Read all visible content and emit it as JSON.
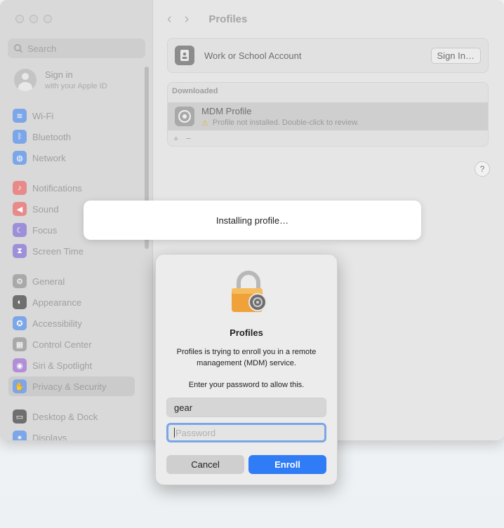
{
  "sidebar": {
    "search_placeholder": "Search",
    "account": {
      "title": "Sign in",
      "subtitle": "with your Apple ID"
    },
    "items": [
      {
        "label": "Wi-Fi",
        "icon": "wifi-icon",
        "color": "#7ca6e8"
      },
      {
        "label": "Bluetooth",
        "icon": "bluetooth-icon",
        "color": "#7ca6e8"
      },
      {
        "label": "Network",
        "icon": "globe-icon",
        "color": "#7ca6e8"
      },
      {
        "label": "Notifications",
        "icon": "bell-icon",
        "color": "#e88a8a"
      },
      {
        "label": "Sound",
        "icon": "speaker-icon",
        "color": "#e88a8a"
      },
      {
        "label": "Focus",
        "icon": "moon-icon",
        "color": "#9d8fd8"
      },
      {
        "label": "Screen Time",
        "icon": "hourglass-icon",
        "color": "#9d8fd8"
      },
      {
        "label": "General",
        "icon": "gear-icon",
        "color": "#a9a9a9"
      },
      {
        "label": "Appearance",
        "icon": "appearance-icon",
        "color": "#6f6f6f"
      },
      {
        "label": "Accessibility",
        "icon": "accessibility-icon",
        "color": "#7ca6e8"
      },
      {
        "label": "Control Center",
        "icon": "control-center-icon",
        "color": "#a9a9a9"
      },
      {
        "label": "Siri & Spotlight",
        "icon": "siri-icon",
        "color": "#b08fd6"
      },
      {
        "label": "Privacy & Security",
        "icon": "hand-icon",
        "color": "#7ca6e8",
        "selected": true
      },
      {
        "label": "Desktop & Dock",
        "icon": "dock-icon",
        "color": "#6f6f6f"
      },
      {
        "label": "Displays",
        "icon": "display-icon",
        "color": "#7ca6e8"
      }
    ]
  },
  "content": {
    "title": "Profiles",
    "work_account_label": "Work or School Account",
    "sign_in_button": "Sign In…",
    "downloaded_header": "Downloaded",
    "mdm": {
      "title": "MDM Profile",
      "status": "Profile not installed. Double-click to review."
    },
    "add_label": "+",
    "remove_label": "−",
    "help_label": "?"
  },
  "installing": {
    "text": "Installing profile…"
  },
  "dialog": {
    "title": "Profiles",
    "message": "Profiles is trying to enroll you in a remote management (MDM) service.",
    "prompt": "Enter your password to allow this.",
    "username_value": "gear",
    "password_placeholder": "Password",
    "cancel_label": "Cancel",
    "enroll_label": "Enroll"
  },
  "colors": {
    "accent": "#2f7cf6",
    "focus_ring": "#7aa6e6"
  }
}
